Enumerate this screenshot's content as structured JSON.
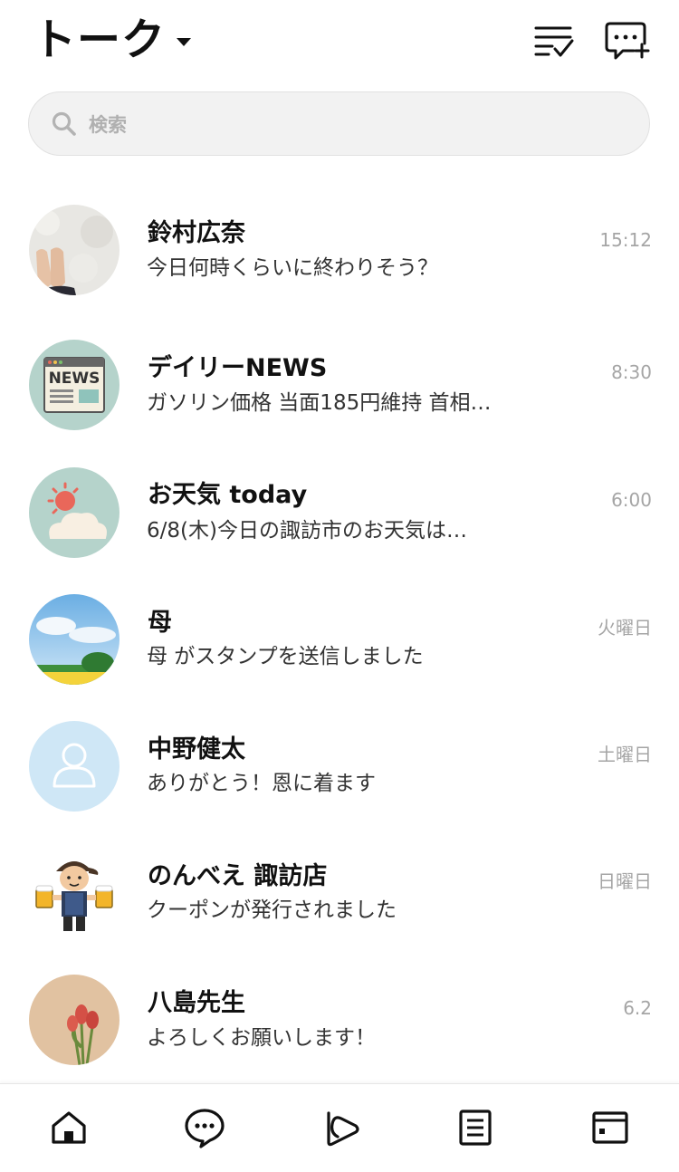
{
  "header": {
    "title": "トーク"
  },
  "search": {
    "placeholder": "検索"
  },
  "chats": [
    {
      "name": "鈴村広奈",
      "preview": "今日何時くらいに終わりそう？",
      "time": "15:12",
      "avatar": "photo-feet-on-sand"
    },
    {
      "name": "デイリーNEWS",
      "preview": "ガソリン価格 当面185円維持 首相…",
      "time": "8:30",
      "avatar": "newspaper-icon"
    },
    {
      "name": "お天気 today",
      "preview": "6/8(木)今日の諏訪市のお天気は…",
      "time": "6:00",
      "avatar": "sun-cloud-icon"
    },
    {
      "name": "母",
      "preview": "母 がスタンプを送信しました",
      "time": "火曜日",
      "avatar": "photo-sky-field"
    },
    {
      "name": "中野健太",
      "preview": "ありがとう！恩に着ます",
      "time": "土曜日",
      "avatar": "default-person-icon"
    },
    {
      "name": "のんべえ 諏訪店",
      "preview": "クーポンが発行されました",
      "time": "日曜日",
      "avatar": "beer-server-mascot"
    },
    {
      "name": "八島先生",
      "preview": "よろしくお願いします！",
      "time": "6.2",
      "avatar": "photo-tulips"
    }
  ],
  "nav": [
    "home-icon",
    "chat-icon",
    "voom-icon",
    "news-icon",
    "wallet-icon"
  ],
  "colors": {
    "background": "#ffffff",
    "search_bg": "#f2f2f2",
    "time_text": "#a5a5a5",
    "avatar_teal": "#b5d3cb",
    "avatar_blue": "#cfe7f6"
  }
}
